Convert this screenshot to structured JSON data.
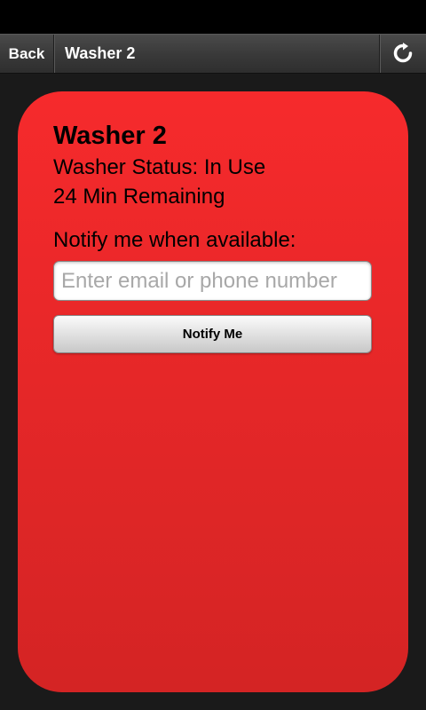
{
  "navbar": {
    "back_label": "Back",
    "title": "Washer 2",
    "refresh_icon": "refresh-icon"
  },
  "card": {
    "title": "Washer 2",
    "status": "Washer Status: In Use",
    "remaining": "24 Min Remaining",
    "notify_label": "Notify me when available:",
    "contact_placeholder": "Enter email or phone number",
    "contact_value": "",
    "notify_button": "Notify Me",
    "status_color": "#f62a2c"
  }
}
